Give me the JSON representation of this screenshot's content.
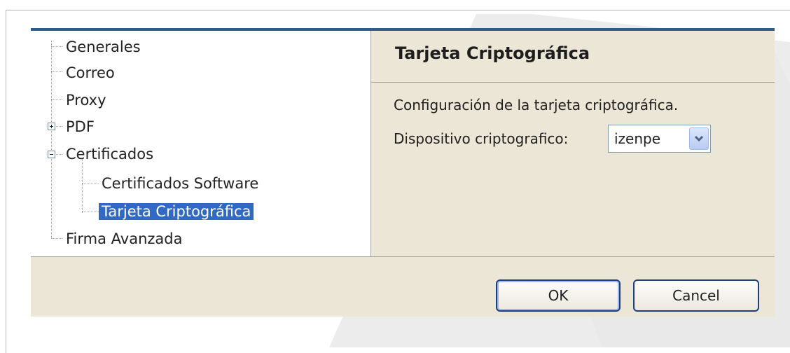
{
  "tree": {
    "items": [
      {
        "label": "Generales"
      },
      {
        "label": "Correo"
      },
      {
        "label": "Proxy"
      },
      {
        "label": "PDF"
      },
      {
        "label": "Certificados"
      },
      {
        "label": "Certificados Software"
      },
      {
        "label": "Tarjeta Criptográfica",
        "selected": true
      },
      {
        "label": "Firma Avanzada"
      }
    ]
  },
  "panel": {
    "title": "Tarjeta Criptográfica",
    "description": "Configuración de la tarjeta criptográfica.",
    "device_label": "Dispositivo criptografico:",
    "device_value": "izenpe"
  },
  "buttons": {
    "ok": "OK",
    "cancel": "Cancel"
  },
  "colors": {
    "selection": "#316ac5",
    "dialog_bg": "#ece6d6",
    "accent_border": "#2f5a8c"
  },
  "icons": {
    "pdf_expander": "plus-expander-icon",
    "certificados_expander": "minus-expander-icon",
    "dropdown": "chevron-down-icon"
  }
}
